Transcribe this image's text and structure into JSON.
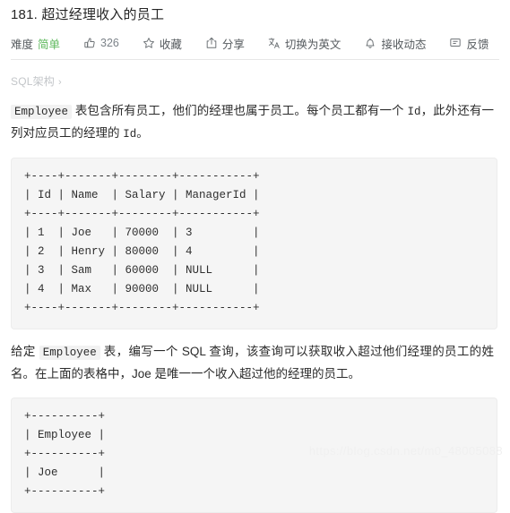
{
  "problem": {
    "title": "181. 超过经理收入的员工"
  },
  "toolbar": {
    "difficulty_label": "难度",
    "difficulty_value": "简单",
    "difficulty_color": "#5db85c",
    "like_count": "326",
    "favorite_label": "收藏",
    "share_label": "分享",
    "translate_label": "切换为英文",
    "subscribe_label": "接收动态",
    "feedback_label": "反馈",
    "icons": {
      "like": "thumbs-up-icon",
      "favorite": "star-icon",
      "share": "share-icon",
      "translate": "translate-icon",
      "subscribe": "bell-icon",
      "feedback": "message-icon"
    }
  },
  "breadcrumb": {
    "label": "SQL架构",
    "chevron": "›"
  },
  "description": {
    "part1_code": "Employee",
    "part1_text": " 表包含所有员工，他们的经理也属于员工。每个员工都有一个 ",
    "part1_mono": "Id",
    "part1_text2": "，此外还有一列对应员工的经理的 ",
    "part1_mono2": "Id",
    "part1_text3": "。"
  },
  "question": {
    "pre_code": "给定 ",
    "code": "Employee",
    "text": " 表，编写一个 SQL 查询，该查询可以获取收入超过他们经理的员工的姓名。在上面的表格中，Joe 是唯一一个收入超过他的经理的员工。"
  },
  "table_block": {
    "content": "+----+-------+--------+-----------+\n| Id | Name  | Salary | ManagerId |\n+----+-------+--------+-----------+\n| 1  | Joe   | 70000  | 3         |\n| 2  | Henry | 80000  | 4         |\n| 3  | Sam   | 60000  | NULL      |\n| 4  | Max   | 90000  | NULL      |\n+----+-------+--------+-----------+"
  },
  "result_block": {
    "content": "+----------+\n| Employee |\n+----------+\n| Joe      |\n+----------+"
  },
  "watermark": {
    "text": "https://blog.csdn.net/m0_48005088"
  }
}
